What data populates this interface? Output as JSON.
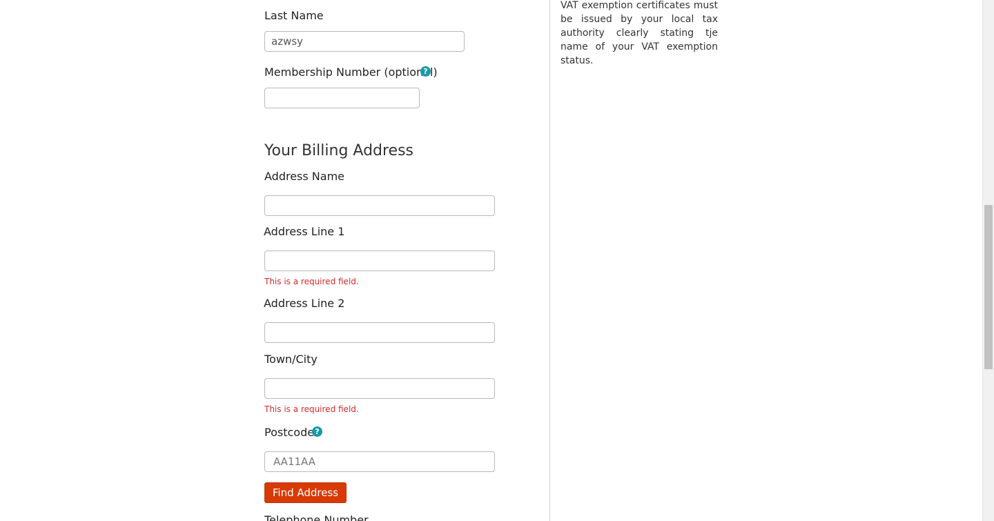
{
  "personal": {
    "last_name_label": "Last Name",
    "last_name_value": "azwsy",
    "membership_label": "Membership Number (optional)",
    "membership_value": "",
    "help_glyph": "?"
  },
  "billing": {
    "heading": "Your Billing Address",
    "address_name_label": "Address Name",
    "address_line1_label": "Address Line 1",
    "address_line1_error": "This is a required field.",
    "address_line2_label": "Address Line 2",
    "town_label": "Town/City",
    "town_error": "This is a required field.",
    "postcode_label": "Postcode",
    "postcode_placeholder": "AA11AA",
    "find_address_label": "Find Address",
    "telephone_label": "Telephone Number"
  },
  "sidebar": {
    "vat_note": "VAT exemption certificates must be issued by your local tax authority clearly stating tje name of your VAT exemption status."
  },
  "colors": {
    "accent": "#d83a06",
    "error": "#d42b2b",
    "help_icon": "#1a9aa8"
  },
  "icons": {
    "help": "help-circle-icon"
  }
}
